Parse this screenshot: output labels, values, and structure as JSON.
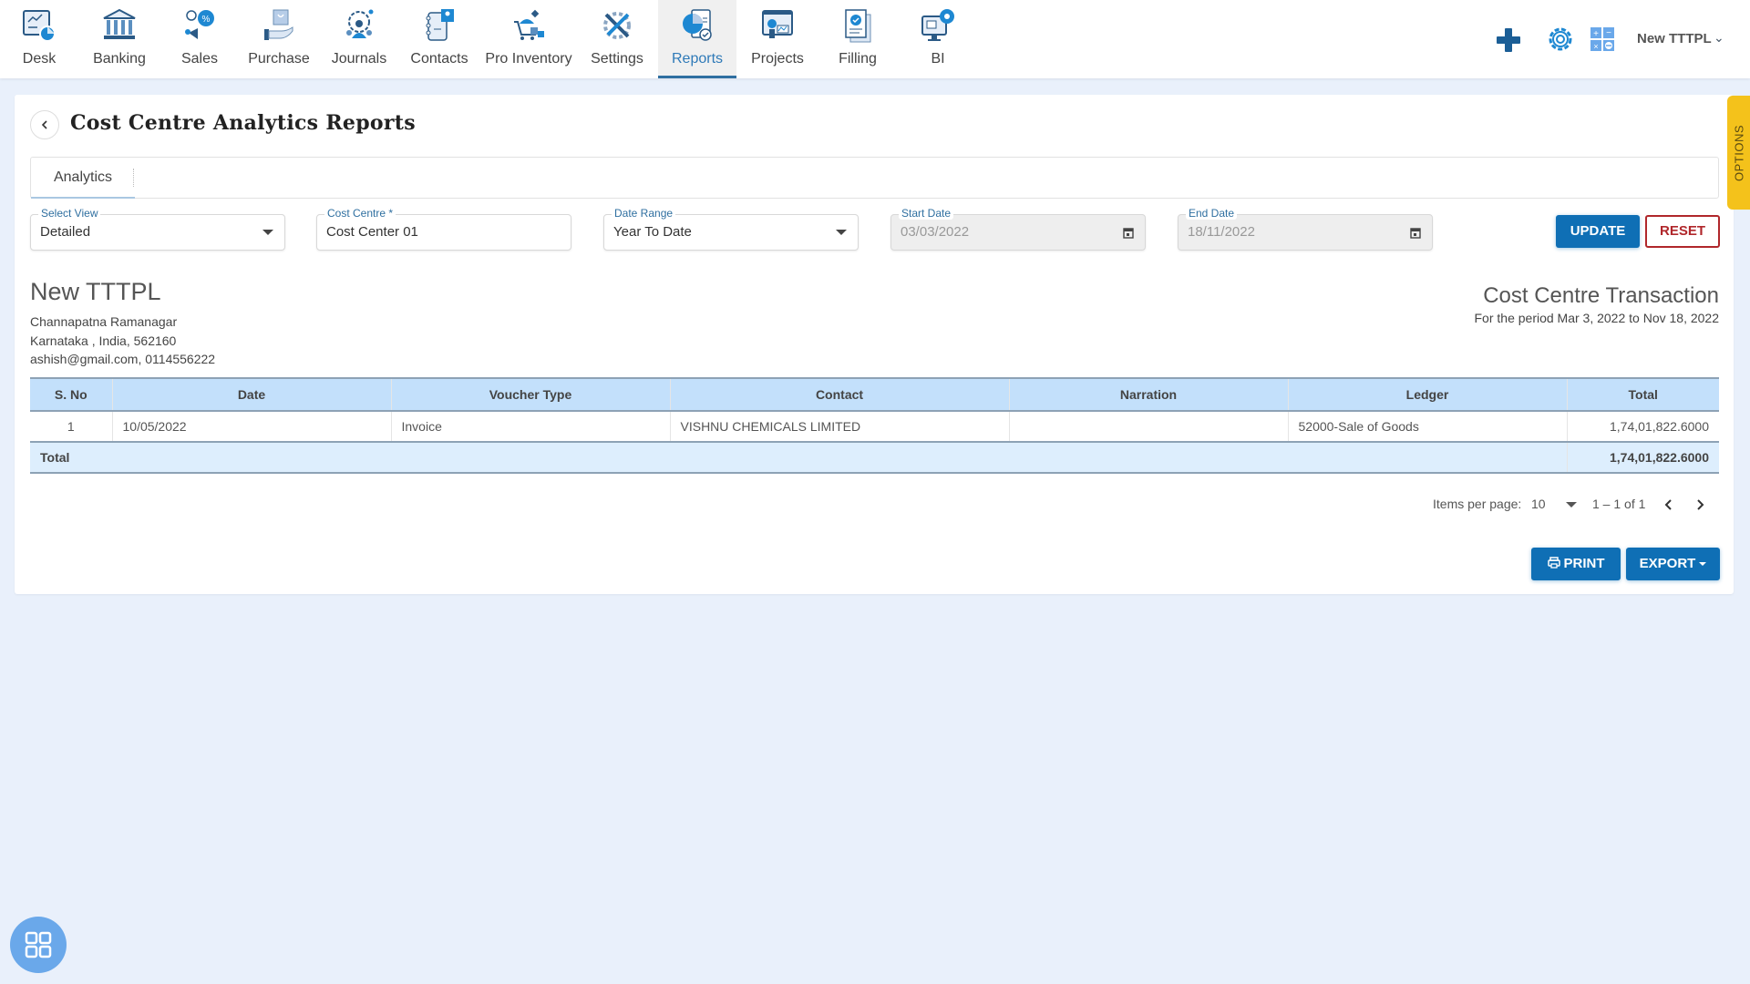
{
  "nav": {
    "items": [
      {
        "label": "Desk",
        "icon": "desk-icon"
      },
      {
        "label": "Banking",
        "icon": "bank-icon"
      },
      {
        "label": "Sales",
        "icon": "sales-icon"
      },
      {
        "label": "Purchase",
        "icon": "purchase-icon"
      },
      {
        "label": "Journals",
        "icon": "journals-icon"
      },
      {
        "label": "Contacts",
        "icon": "contacts-icon"
      },
      {
        "label": "Pro Inventory",
        "icon": "inventory-icon"
      },
      {
        "label": "Settings",
        "icon": "settings-icon"
      },
      {
        "label": "Reports",
        "icon": "reports-icon",
        "active": true
      },
      {
        "label": "Projects",
        "icon": "projects-icon"
      },
      {
        "label": "Filling",
        "icon": "filling-icon"
      },
      {
        "label": "BI",
        "icon": "bi-icon"
      }
    ],
    "right": {
      "add_icon": "plus-icon",
      "settings_icon": "gear-icon",
      "calculator_icon": "calculator-icon",
      "company": "New TTTPL"
    }
  },
  "page": {
    "title": "Cost Centre Analytics Reports",
    "tabs": [
      {
        "label": "Analytics",
        "active": true
      }
    ],
    "options_tab": "OPTIONS"
  },
  "filters": {
    "select_view": {
      "label": "Select View",
      "value": "Detailed"
    },
    "cost_centre": {
      "label": "Cost Centre *",
      "value": "Cost Center 01"
    },
    "date_range": {
      "label": "Date Range",
      "value": "Year To Date"
    },
    "start_date": {
      "label": "Start Date",
      "value": "03/03/2022"
    },
    "end_date": {
      "label": "End Date",
      "value": "18/11/2022"
    },
    "update_label": "UPDATE",
    "reset_label": "RESET"
  },
  "company": {
    "name": "New TTTPL",
    "address1": "Channapatna Ramanagar",
    "address2": "Karnataka , India, 562160",
    "contact": "ashish@gmail.com, 0114556222"
  },
  "report": {
    "title": "Cost Centre Transaction",
    "period": "For the period Mar 3, 2022 to Nov 18, 2022"
  },
  "table": {
    "columns": [
      "S. No",
      "Date",
      "Voucher Type",
      "Contact",
      "Narration",
      "Ledger",
      "Total"
    ],
    "rows": [
      {
        "sno": "1",
        "date": "10/05/2022",
        "voucher_type": "Invoice",
        "contact": "VISHNU CHEMICALS LIMITED",
        "narration": "",
        "ledger": "52000-Sale of Goods",
        "total": "1,74,01,822.6000"
      }
    ],
    "total_label": "Total",
    "total_value": "1,74,01,822.6000"
  },
  "pagination": {
    "items_per_page_label": "Items per page:",
    "items_per_page": "10",
    "range": "1 – 1 of 1"
  },
  "actions": {
    "print_label": "PRINT",
    "export_label": "EXPORT"
  },
  "colors": {
    "primary": "#0f6fb5",
    "reset": "#b0272b",
    "options": "#f4c21b",
    "table_header": "#c3e0fb"
  }
}
